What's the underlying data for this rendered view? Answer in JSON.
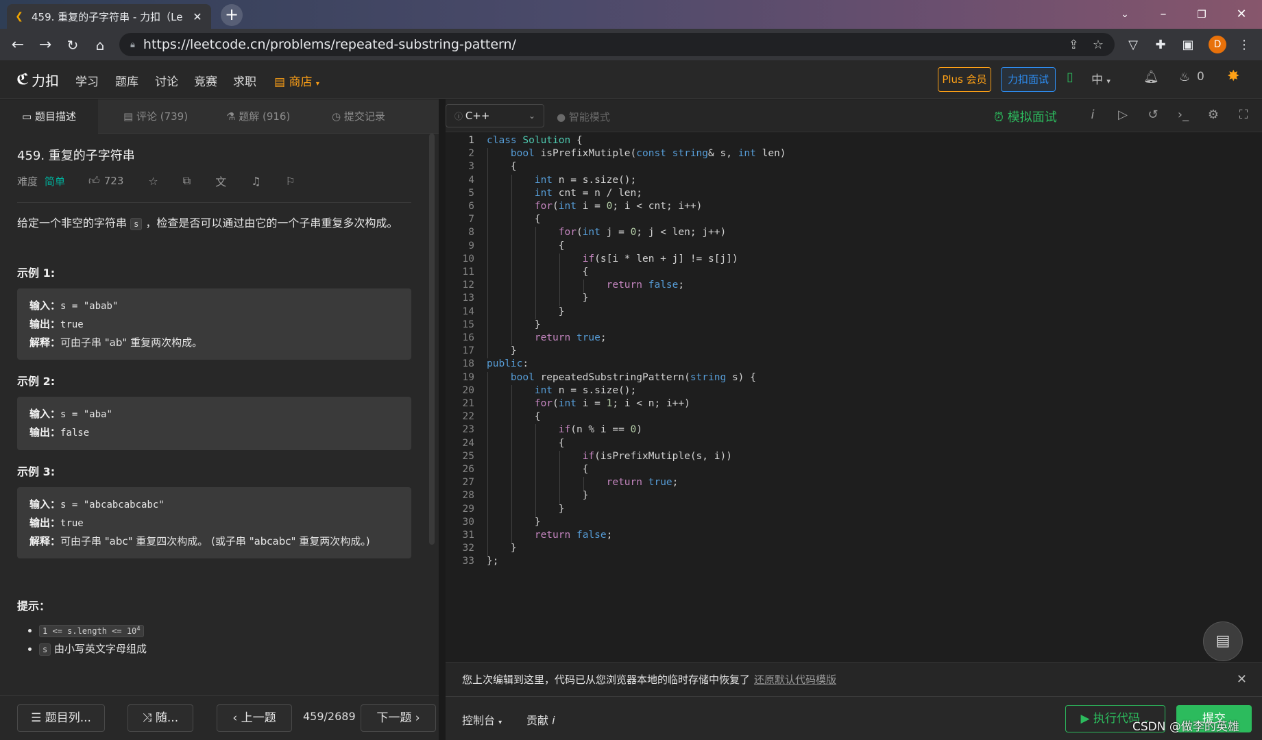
{
  "browser": {
    "tab_title": "459. 重复的子字符串 - 力扣（Le",
    "url": "https://leetcode.cn/problems/repeated-substring-pattern/",
    "profile_initial": "D"
  },
  "header": {
    "logo_text": "力扣",
    "nav": [
      "学习",
      "题库",
      "讨论",
      "竞赛",
      "求职"
    ],
    "shop": "商店",
    "plus": "Plus 会员",
    "mock_interview": "力扣面试",
    "lang": "中",
    "points": "0"
  },
  "left_tabs": {
    "description": "题目描述",
    "comments": "评论 (739)",
    "solutions": "题解 (916)",
    "submissions": "提交记录"
  },
  "problem": {
    "title": "459. 重复的子字符串",
    "difficulty_label": "难度",
    "difficulty": "简单",
    "likes": "723",
    "desc_before": "给定一个非空的字符串 ",
    "desc_var": "s",
    "desc_after": " ，检查是否可以通过由它的一个子串重复多次构成。",
    "examples": [
      {
        "heading": "示例 1:",
        "input_label": "输入：",
        "input": "s = \"abab\"",
        "output_label": "输出：",
        "output": "true",
        "explain_label": "解释：",
        "explain": "可由子串 \"ab\" 重复两次构成。"
      },
      {
        "heading": "示例 2:",
        "input_label": "输入：",
        "input": "s = \"aba\"",
        "output_label": "输出：",
        "output": "false"
      },
      {
        "heading": "示例 3:",
        "input_label": "输入：",
        "input": "s = \"abcabcabcabc\"",
        "output_label": "输出：",
        "output": "true",
        "explain_label": "解释：",
        "explain": "可由子串 \"abc\" 重复四次构成。 (或子串 \"abcabc\" 重复两次构成。)"
      }
    ],
    "hints_heading": "提示：",
    "hint1": "1 <= s.length <= 10",
    "hint1_sup": "4",
    "hint2_var": "s",
    "hint2": " 由小写英文字母组成"
  },
  "left_bottom": {
    "list": "题目列...",
    "random": "随...",
    "prev": "上一题",
    "counter": "459/2689",
    "next": "下一题"
  },
  "editor_toolbar": {
    "language": "C++",
    "smart_mode": "智能模式",
    "mock": "模拟面试"
  },
  "code_lines": [
    "class Solution {",
    "    bool isPrefixMutiple(const string& s, int len)",
    "    {",
    "        int n = s.size();",
    "        int cnt = n / len;",
    "        for(int i = 0; i < cnt; i++)",
    "        {",
    "            for(int j = 0; j < len; j++)",
    "            {",
    "                if(s[i * len + j] != s[j])",
    "                {",
    "                    return false;",
    "                }",
    "            }",
    "        }",
    "        return true;",
    "    }",
    "public:",
    "    bool repeatedSubstringPattern(string s) {",
    "        int n = s.size();",
    "        for(int i = 1; i < n; i++)",
    "        {",
    "            if(n % i == 0)",
    "            {",
    "                if(isPrefixMutiple(s, i))",
    "                {",
    "                    return true;",
    "                }",
    "            }",
    "        }",
    "        return false;",
    "    }",
    "};"
  ],
  "notice": {
    "text": "您上次编辑到这里，代码已从您浏览器本地的临时存储中恢复了",
    "restore": "还原默认代码模版"
  },
  "right_bottom": {
    "console": "控制台",
    "contribute": "贡献",
    "run": "执行代码",
    "submit": "提交"
  },
  "watermark": "CSDN @做李的英雄"
}
